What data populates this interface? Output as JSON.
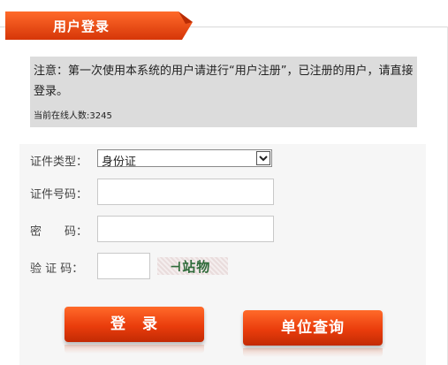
{
  "header": {
    "title": "用户登录"
  },
  "notice": {
    "text": "注意：第一次使用本系统的用户请进行“用户注册”，已注册的用户，请直接登录。",
    "online_count_text": "当前在线人数:3245"
  },
  "form": {
    "id_type": {
      "label": "证件类型：",
      "selected": "身份证"
    },
    "id_number": {
      "label": "证件号码：",
      "value": ""
    },
    "password": {
      "label": "密　　码：",
      "value": ""
    },
    "captcha": {
      "label": "验 证 码：",
      "value": "",
      "image_text": "⊣站物"
    }
  },
  "buttons": {
    "login": "登　录",
    "unit_query": "单位查询"
  },
  "colors": {
    "accent": "#e8470f",
    "notice_bg": "#dcdcdc",
    "panel_bg": "#f6f6f6"
  }
}
